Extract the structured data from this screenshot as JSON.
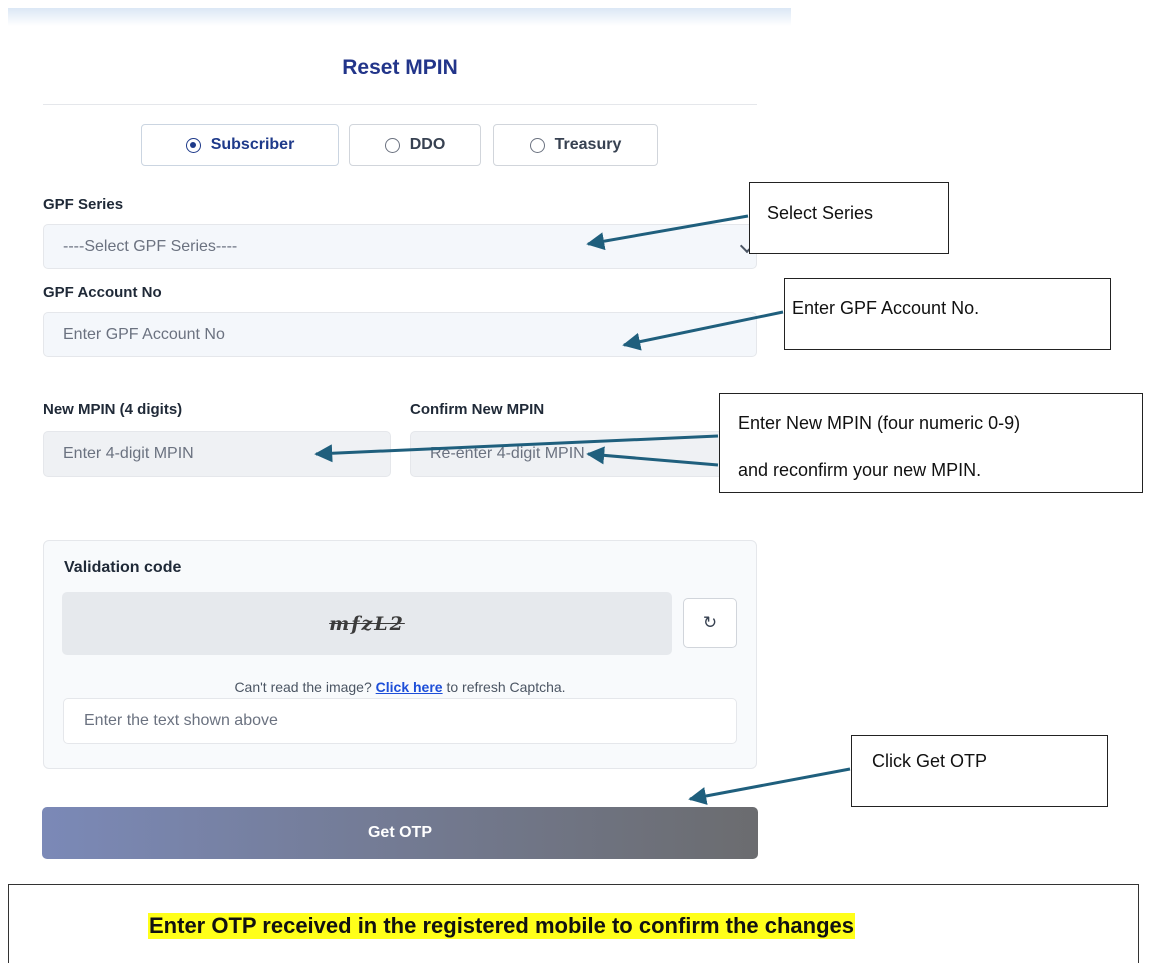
{
  "form": {
    "title": "Reset MPIN",
    "user_types": [
      {
        "label": "Subscriber",
        "selected": true
      },
      {
        "label": "DDO",
        "selected": false
      },
      {
        "label": "Treasury",
        "selected": false
      }
    ],
    "gpf_series": {
      "label": "GPF Series",
      "selected": "----Select GPF Series----"
    },
    "gpf_account": {
      "label": "GPF Account No",
      "placeholder": "Enter GPF Account No"
    },
    "new_mpin": {
      "label": "New MPIN (4 digits)",
      "placeholder": "Enter 4-digit MPIN"
    },
    "confirm_mpin": {
      "label": "Confirm New MPIN",
      "placeholder": "Re-enter 4-digit MPIN"
    },
    "validation": {
      "title": "Validation code",
      "captcha_text": "mfzL2",
      "refresh_icon": "refresh-icon",
      "cant_read": "Can't read the image?",
      "click_here": "Click here",
      "refresh_suffix": "to refresh Captcha.",
      "input_placeholder": "Enter the text shown above"
    },
    "get_otp_label": "Get OTP"
  },
  "callouts": {
    "select_series": "Select Series",
    "enter_gpf": "Enter GPF Account No.",
    "mpin_line1": "Enter New MPIN (four numeric 0-9)",
    "mpin_line2": "and reconfirm your new MPIN.",
    "click_get_otp": "Click Get OTP"
  },
  "note": "Enter OTP received in the registered mobile to confirm the changes",
  "colors": {
    "title": "#22358a",
    "arrow": "#1f5f7d",
    "highlight": "#ffff1a"
  }
}
